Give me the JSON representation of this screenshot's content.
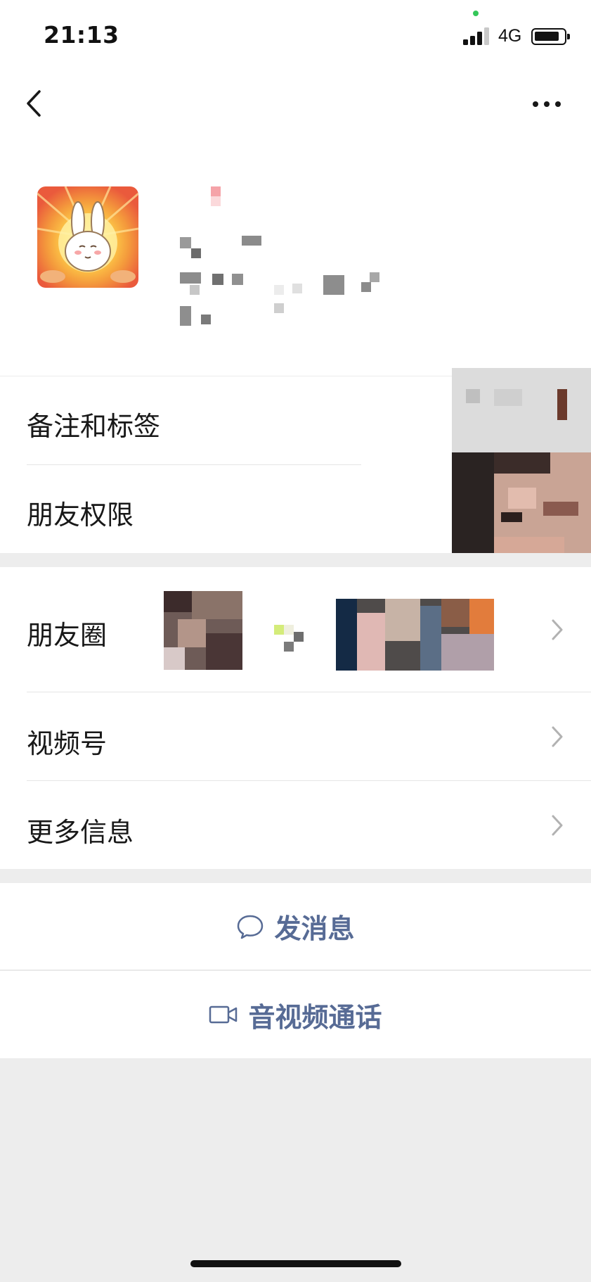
{
  "status_bar": {
    "time": "21:13",
    "network": "4G"
  },
  "profile": {
    "avatar_alt": ""
  },
  "rows": {
    "remark_tags": "备注和标签",
    "friend_permissions": "朋友权限",
    "moments": "朋友圈",
    "channels": "视频号",
    "more_info": "更多信息"
  },
  "actions": {
    "send_message": "发消息",
    "video_call": "音视频通话"
  },
  "colors": {
    "link_blue": "#576b95",
    "background": "#ededed",
    "card": "#ffffff"
  },
  "icons": {
    "back": "chevron-left-icon",
    "more": "more-dots-icon",
    "row_arrow": "chevron-right-icon",
    "message": "chat-bubble-icon",
    "video": "video-camera-icon"
  }
}
